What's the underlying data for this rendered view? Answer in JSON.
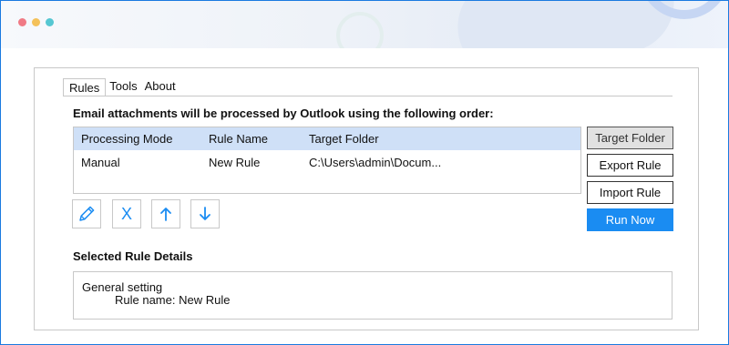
{
  "tabs": [
    {
      "label": "Rules",
      "active": true
    },
    {
      "label": "Tools",
      "active": false
    },
    {
      "label": "About",
      "active": false
    }
  ],
  "heading": "Email attachments will be processed by Outlook using the following order:",
  "table": {
    "columns": [
      "Processing Mode",
      "Rule Name",
      "Target Folder"
    ],
    "rows": [
      [
        "Manual",
        "New Rule",
        "C:\\Users\\admin\\Docum..."
      ]
    ]
  },
  "side_buttons": {
    "target_folder": "Target Folder",
    "export_rule": "Export Rule",
    "import_rule": "Import Rule",
    "run_now": "Run Now"
  },
  "icon_buttons": [
    {
      "icon": "pencil-icon"
    },
    {
      "icon": "x-icon",
      "glyph": "X"
    },
    {
      "icon": "arrow-up-icon"
    },
    {
      "icon": "arrow-down-icon"
    }
  ],
  "details": {
    "title": "Selected Rule Details",
    "line1": "General setting",
    "line2": "Rule name: New Rule"
  },
  "colors": {
    "accent": "#1a8cf2",
    "header_row": "#cfe0f7",
    "frame_border": "#1a7ae0"
  }
}
